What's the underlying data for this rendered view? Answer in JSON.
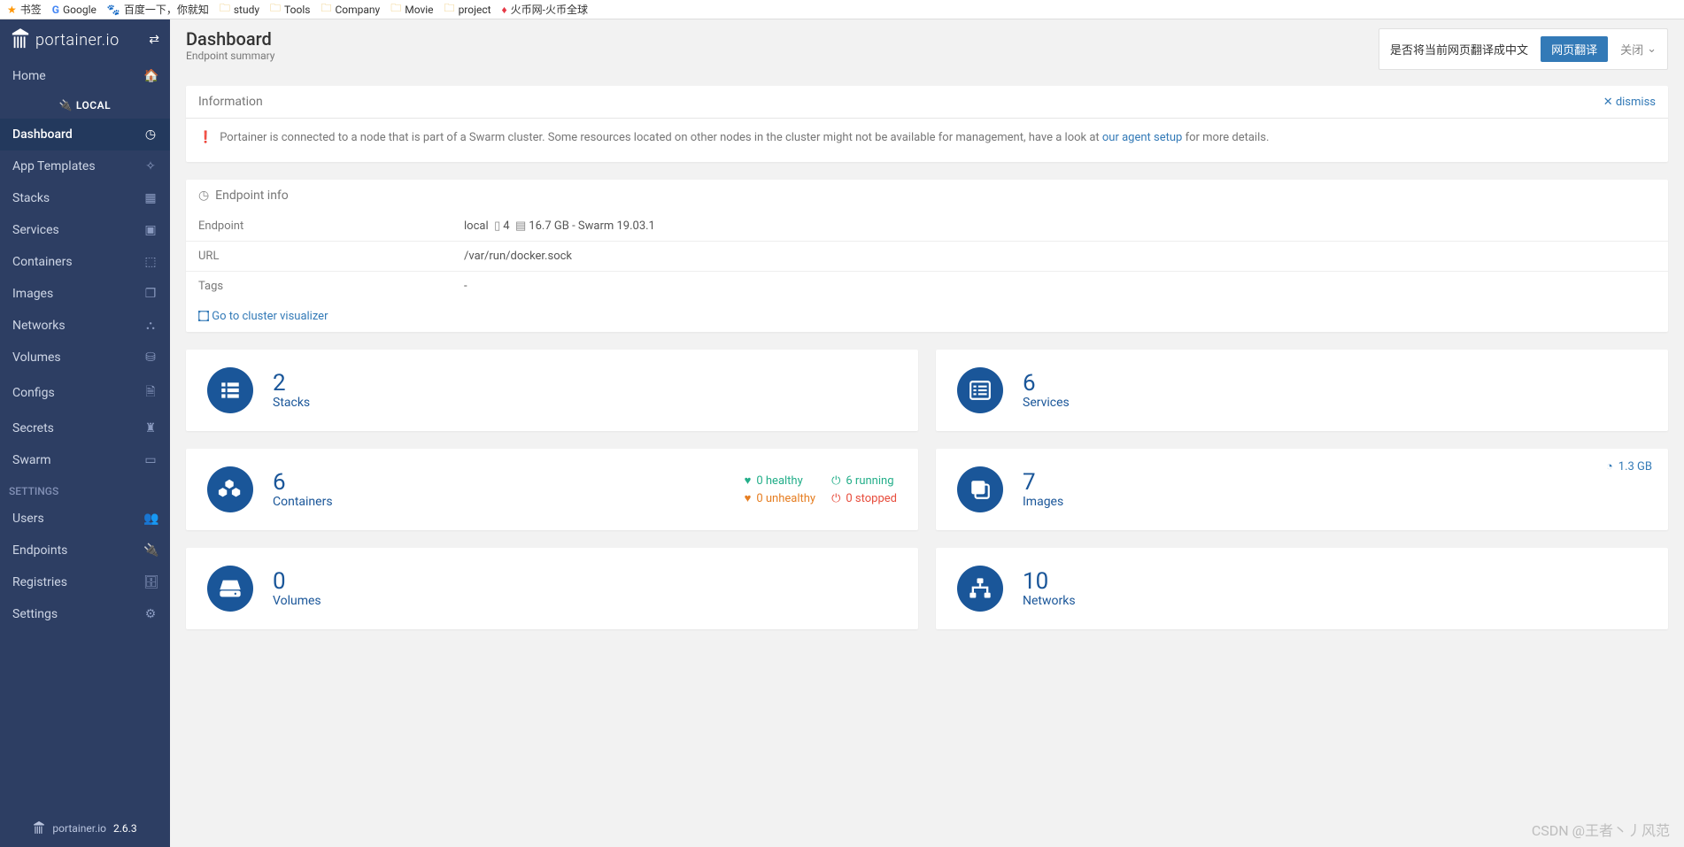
{
  "bookmarks": [
    {
      "label": "书签",
      "kind": "star"
    },
    {
      "label": "Google",
      "kind": "g"
    },
    {
      "label": "百度一下，你就知",
      "kind": "paw"
    },
    {
      "label": "study",
      "kind": "folder"
    },
    {
      "label": "Tools",
      "kind": "folder"
    },
    {
      "label": "Company",
      "kind": "folder"
    },
    {
      "label": "Movie",
      "kind": "folder"
    },
    {
      "label": "project",
      "kind": "folder"
    },
    {
      "label": "火币网-火币全球",
      "kind": "fire"
    }
  ],
  "brand": "portainer.io",
  "version": "2.6.3",
  "header": {
    "title": "Dashboard",
    "subtitle": "Endpoint summary"
  },
  "translate": {
    "prompt": "是否将当前网页翻译成中文",
    "translate_btn": "网页翻译",
    "close": "关闭"
  },
  "sidebar": {
    "home": "Home",
    "local": "LOCAL",
    "items": [
      {
        "label": "Dashboard"
      },
      {
        "label": "App Templates"
      },
      {
        "label": "Stacks"
      },
      {
        "label": "Services"
      },
      {
        "label": "Containers"
      },
      {
        "label": "Images"
      },
      {
        "label": "Networks"
      },
      {
        "label": "Volumes"
      },
      {
        "label": "Configs"
      },
      {
        "label": "Secrets"
      },
      {
        "label": "Swarm"
      }
    ],
    "settings_label": "SETTINGS",
    "settings": [
      {
        "label": "Users"
      },
      {
        "label": "Endpoints"
      },
      {
        "label": "Registries"
      },
      {
        "label": "Settings"
      }
    ]
  },
  "info_panel": {
    "title": "Information",
    "dismiss": "dismiss",
    "message_pre": "Portainer is connected to a node that is part of a Swarm cluster. Some resources located on other nodes in the cluster might not be available for management, have a look at ",
    "message_link": "our agent setup",
    "message_post": " for more details."
  },
  "endpoint_panel": {
    "title": "Endpoint info",
    "rows": {
      "endpoint_label": "Endpoint",
      "endpoint_name": "local",
      "cpu": "4",
      "memory": "16.7 GB",
      "swarm": " - Swarm 19.03.1",
      "url_label": "URL",
      "url_value": "/var/run/docker.sock",
      "tags_label": "Tags",
      "tags_value": "-"
    },
    "visualizer": "Go to cluster visualizer"
  },
  "tiles": {
    "stacks": {
      "count": "2",
      "label": "Stacks"
    },
    "services": {
      "count": "6",
      "label": "Services"
    },
    "containers": {
      "count": "6",
      "label": "Containers",
      "healthy": "0 healthy",
      "running": "6 running",
      "unhealthy": "0 unhealthy",
      "stopped": "0 stopped"
    },
    "images": {
      "count": "7",
      "label": "Images",
      "size": "1.3 GB"
    },
    "volumes": {
      "count": "0",
      "label": "Volumes"
    },
    "networks": {
      "count": "10",
      "label": "Networks"
    }
  },
  "watermark": "CSDN @王者丶丿风范"
}
